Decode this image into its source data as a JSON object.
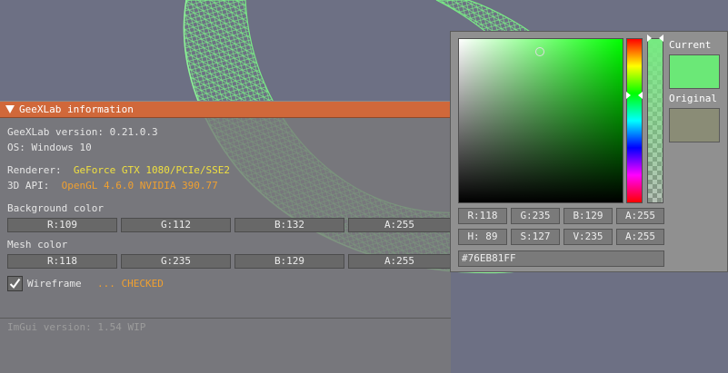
{
  "colors": {
    "background": "#6d7084",
    "mesh": "#76eb81",
    "title_bar": "#d0683a",
    "current_swatch": "#6be877",
    "original_swatch": "#8a8c76"
  },
  "info_window": {
    "title": "GeeXLab information",
    "version_line": "GeeXLab version: 0.21.0.3",
    "os_line": "OS: Windows 10",
    "renderer_label": "Renderer:",
    "renderer_value": "GeForce GTX 1080/PCIe/SSE2",
    "api_label": "3D API:",
    "api_value": "OpenGL 4.6.0 NVIDIA 390.77",
    "background_color_label": "Background color",
    "background_color": {
      "r": "R:109",
      "g": "G:112",
      "b": "B:132",
      "a": "A:255"
    },
    "mesh_color_label": "Mesh color",
    "mesh_color": {
      "r": "R:118",
      "g": "G:235",
      "b": "B:129",
      "a": "A:255"
    },
    "wireframe_label": "Wireframe",
    "wireframe_status": "... CHECKED",
    "wireframe_checked": true,
    "imgui_version": "ImGui version: 1.54 WIP"
  },
  "color_picker": {
    "current_label": "Current",
    "original_label": "Original",
    "rgba": {
      "r": "R:118",
      "g": "G:235",
      "b": "B:129",
      "a": "A:255"
    },
    "hsva": {
      "h": "H: 89",
      "s": "S:127",
      "v": "V:235",
      "a": "A:255"
    },
    "hex": "#76EB81FF"
  }
}
